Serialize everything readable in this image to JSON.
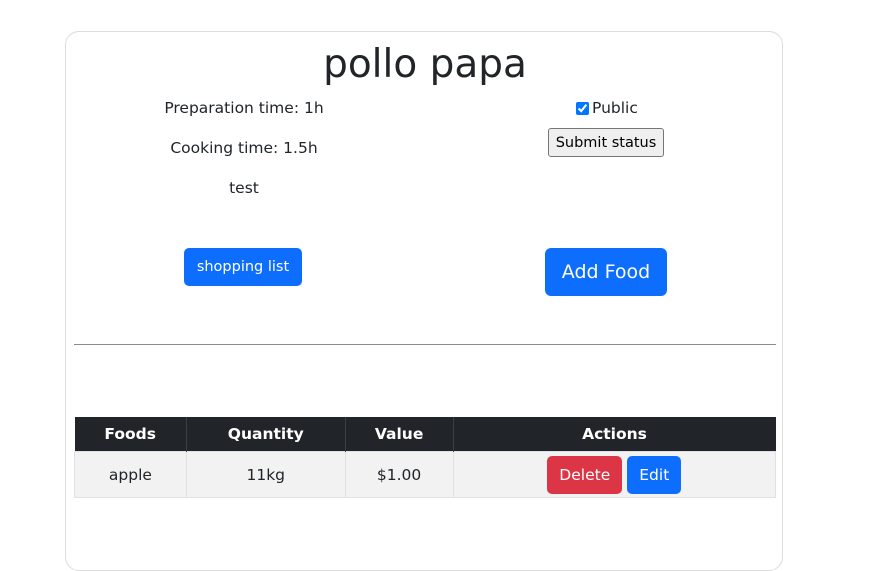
{
  "recipe": {
    "title": "pollo papa",
    "preparation_time": "Preparation time: 1h",
    "cooking_time": "Cooking time: 1.5h",
    "description": "test",
    "public_label": "Public",
    "public_checked": true
  },
  "buttons": {
    "shopping_list": "shopping list",
    "submit_status": "Submit status",
    "add_food": "Add Food"
  },
  "table": {
    "headers": [
      "Foods",
      "Quantity",
      "Value",
      "Actions"
    ],
    "rows": [
      {
        "food": "apple",
        "quantity": "11kg",
        "value": "$1.00",
        "delete_label": "Delete",
        "edit_label": "Edit"
      }
    ]
  },
  "colors": {
    "primary": "#0d6efd",
    "danger": "#dc3545",
    "table_header": "#212529"
  }
}
